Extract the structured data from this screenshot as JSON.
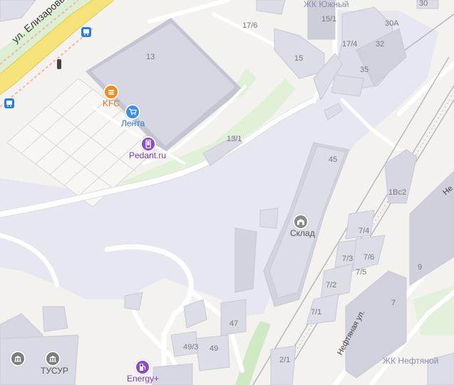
{
  "streets": {
    "elizarovykh": "ул. Елизаровых",
    "neftyanaya": "Нефтяная ул.",
    "ne_partial": "Не"
  },
  "districts": {
    "yuzhny": "ЖК Южный",
    "neftyanoy": "ЖК Нефтяной"
  },
  "buildings": {
    "b30": "30",
    "b17_6": "17/6",
    "b15_1": "15/1",
    "b30a": "30А",
    "b17_4": "17/4",
    "b32": "32",
    "b13": "13",
    "b15": "15",
    "b35": "35",
    "b13_1": "13/1",
    "b45": "45",
    "b1vs2": "1Вс2",
    "b7_4": "7/4",
    "b7_3": "7/3",
    "b7_6": "7/6",
    "b7_5": "7/5",
    "b9": "9",
    "b7_2": "7/2",
    "b7": "7",
    "b7_1": "7/1",
    "b47": "47",
    "b49_3": "49/3",
    "b49": "49",
    "b2_1": "2/1"
  },
  "pois": {
    "kfc": {
      "label": "KFC",
      "icon": "fast-food-icon",
      "color": "#f08a24"
    },
    "lenta": {
      "label": "Лента",
      "icon": "shopping-cart-icon",
      "color": "#3a8ee6"
    },
    "pedant": {
      "label": "Pedant.ru",
      "icon": "phone-repair-icon",
      "color": "#8b4bc4"
    },
    "sklad": {
      "label": "Склад",
      "icon": "warehouse-icon",
      "color": "#8a8a8a"
    },
    "tusur": {
      "label": "ТУСУР",
      "icon": "university-icon",
      "color": "#7d7d7d"
    },
    "energy": {
      "label": "Energy+",
      "icon": "fuel-station-icon",
      "color": "#8b4bc4"
    }
  },
  "colors": {
    "background": "#f4f2ee",
    "industrial": "#e6e7f0",
    "building": "#dcdde6",
    "building_roof": "#c9cad6",
    "green": "#dcefd2",
    "road": "#ffffff",
    "road_edge": "#d8d8d8",
    "main_road": "#f6e27a",
    "railway": "#b8b8c0"
  }
}
